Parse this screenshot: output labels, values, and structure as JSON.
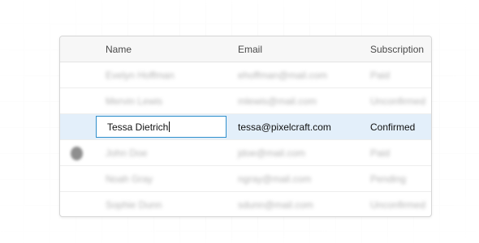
{
  "table": {
    "headers": {
      "name": "Name",
      "email": "Email",
      "subscription": "Subscription"
    },
    "rows": [
      {
        "name": "Evelyn Hoffman",
        "email": "ehoffman@mail.com",
        "subscription": "Paid"
      },
      {
        "name": "Mervin Lewis",
        "email": "mlewis@mail.com",
        "subscription": "Unconfirmed"
      },
      {
        "name": "Tessa Dietrich",
        "email": "tessa@pixelcraft.com",
        "subscription": "Confirmed"
      },
      {
        "name": "John Doe",
        "email": "jdoe@mail.com",
        "subscription": "Paid"
      },
      {
        "name": "Noah Gray",
        "email": "ngray@mail.com",
        "subscription": "Pending"
      },
      {
        "name": "Sophie Dunn",
        "email": "sdunn@mail.com",
        "subscription": "Unconfirmed"
      }
    ]
  },
  "editor": {
    "value": "Tessa Dietrich"
  },
  "colors": {
    "accent": "#2f8fcc",
    "selected_row": "#e3effa"
  }
}
